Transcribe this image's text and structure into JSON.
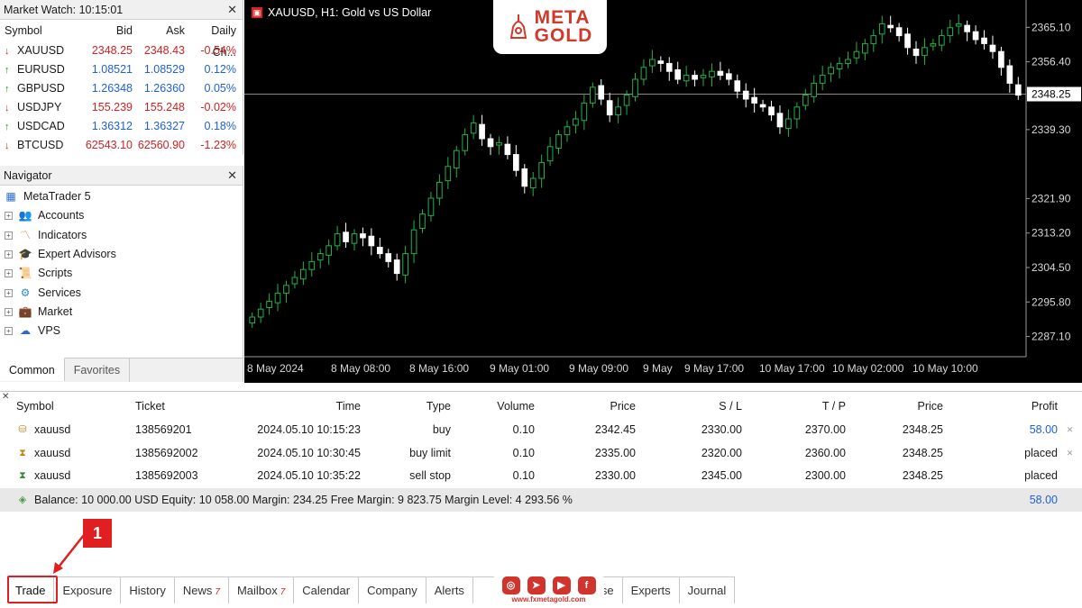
{
  "market_watch": {
    "title": "Market Watch: 10:15:01",
    "columns": [
      "Symbol",
      "Bid",
      "Ask",
      "Daily Ch..."
    ],
    "rows": [
      {
        "symbol": "XAUUSD",
        "bid": "2348.25",
        "ask": "2348.43",
        "change": "-0.54%",
        "dir": "down"
      },
      {
        "symbol": "EURUSD",
        "bid": "1.08521",
        "ask": "1.08529",
        "change": "0.12%",
        "dir": "up"
      },
      {
        "symbol": "GBPUSD",
        "bid": "1.26348",
        "ask": "1.26360",
        "change": "0.05%",
        "dir": "up"
      },
      {
        "symbol": "USDJPY",
        "bid": "155.239",
        "ask": "155.248",
        "change": "-0.02%",
        "dir": "down"
      },
      {
        "symbol": "USDCAD",
        "bid": "1.36312",
        "ask": "1.36327",
        "change": "0.18%",
        "dir": "up"
      },
      {
        "symbol": "BTCUSD",
        "bid": "62543.10",
        "ask": "62560.90",
        "change": "-1.23%",
        "dir": "down"
      }
    ]
  },
  "navigator": {
    "title": "Navigator",
    "root": "MetaTrader 5",
    "items": [
      "Accounts",
      "Indicators",
      "Expert Advisors",
      "Scripts",
      "Services",
      "Market",
      "VPS"
    ],
    "tabs": [
      "Common",
      "Favorites"
    ]
  },
  "chart": {
    "title": "XAUUSD, H1:  Gold vs US Dollar",
    "price_labels": [
      "2365.10",
      "2356.40",
      "2339.30",
      "2321.90",
      "2313.20",
      "2304.50",
      "2295.80",
      "2287.10"
    ],
    "current_price": "2348.25",
    "time_labels": [
      "8 May 2024",
      "8 May 08:00",
      "8 May 16:00",
      "9 May 01:00",
      "9 May 09:00",
      "9 May",
      "9 May 17:00",
      "10 May 17:00",
      "10 May 02:000",
      "10 May 10:00"
    ]
  },
  "logo": {
    "line1": "META",
    "line2": "GOLD"
  },
  "trade": {
    "columns": [
      "Symbol",
      "Ticket",
      "Time",
      "Type",
      "Volume",
      "Price",
      "S / L",
      "T / P",
      "Price",
      "Profit"
    ],
    "rows": [
      {
        "symbol": "xauusd",
        "ticket": "138569201",
        "time": "2024.05.10 10:15:23",
        "type": "buy",
        "volume": "0.10",
        "price": "2342.45",
        "sl": "2330.00",
        "tp": "2370.00",
        "cur": "2348.25",
        "profit": "58.00"
      },
      {
        "symbol": "xauusd",
        "ticket": "1385692002",
        "time": "2024.05.10 10:30:45",
        "type": "buy limit",
        "volume": "0.10",
        "price": "2335.00",
        "sl": "2320.00",
        "tp": "2360.00",
        "cur": "2348.25",
        "profit": "placed"
      },
      {
        "symbol": "xauusd",
        "ticket": "1385692003",
        "time": "2024.05.10 10:35:22",
        "type": "sell stop",
        "volume": "0.10",
        "price": "2330.00",
        "sl": "2345.00",
        "tp": "2300.00",
        "cur": "2348.25",
        "profit": "placed"
      }
    ],
    "balance_line": "Balance: 10 000.00  USD  Equity: 10 058.00  Margin: 234.25  Free Margin: 9 823.75  Margin Level: 4 293.56 %",
    "balance_profit": "58.00"
  },
  "toolbox_tabs": [
    {
      "label": "Trade",
      "badge": ""
    },
    {
      "label": "Exposure",
      "badge": ""
    },
    {
      "label": "History",
      "badge": ""
    },
    {
      "label": "News",
      "badge": "7"
    },
    {
      "label": "Mailbox",
      "badge": "7"
    },
    {
      "label": "Calendar",
      "badge": ""
    },
    {
      "label": "Company",
      "badge": ""
    },
    {
      "label": "Alerts",
      "badge": ""
    },
    {
      "label": "Base",
      "badge": ""
    },
    {
      "label": "Experts",
      "badge": ""
    },
    {
      "label": "Journal",
      "badge": ""
    }
  ],
  "annotation": {
    "step": "1"
  },
  "social": {
    "url": "www.fxmetagold.com",
    "icons": [
      "instagram-icon",
      "telegram-icon",
      "youtube-icon",
      "facebook-icon"
    ]
  },
  "colors": {
    "bull": "#22b14c",
    "bear": "#ffffff",
    "accent": "#e02020",
    "price_blue": "#1f5fd6"
  }
}
